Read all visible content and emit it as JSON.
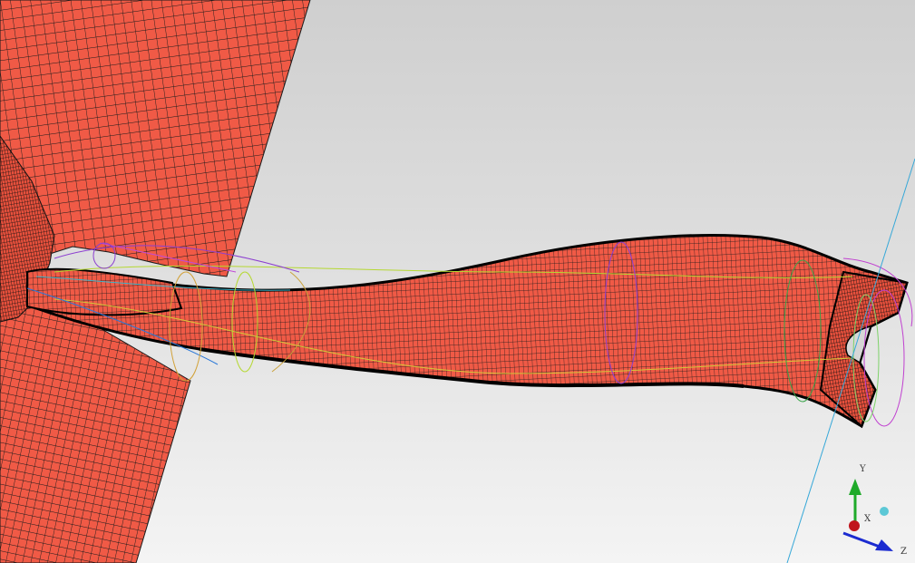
{
  "viewport": {
    "background_top": "#cfcfcf",
    "background_bottom": "#f4f4f4"
  },
  "mesh": {
    "surface_color": "#f05a46",
    "line_color": "#1a1a1a"
  },
  "triad": {
    "y_label": "Y",
    "x_label": "X",
    "z_label": "Z",
    "y_color": "#1faa2a",
    "x_color": "#c0141c",
    "z_color": "#1b2bd0",
    "extra_color": "#5cc8d6"
  }
}
